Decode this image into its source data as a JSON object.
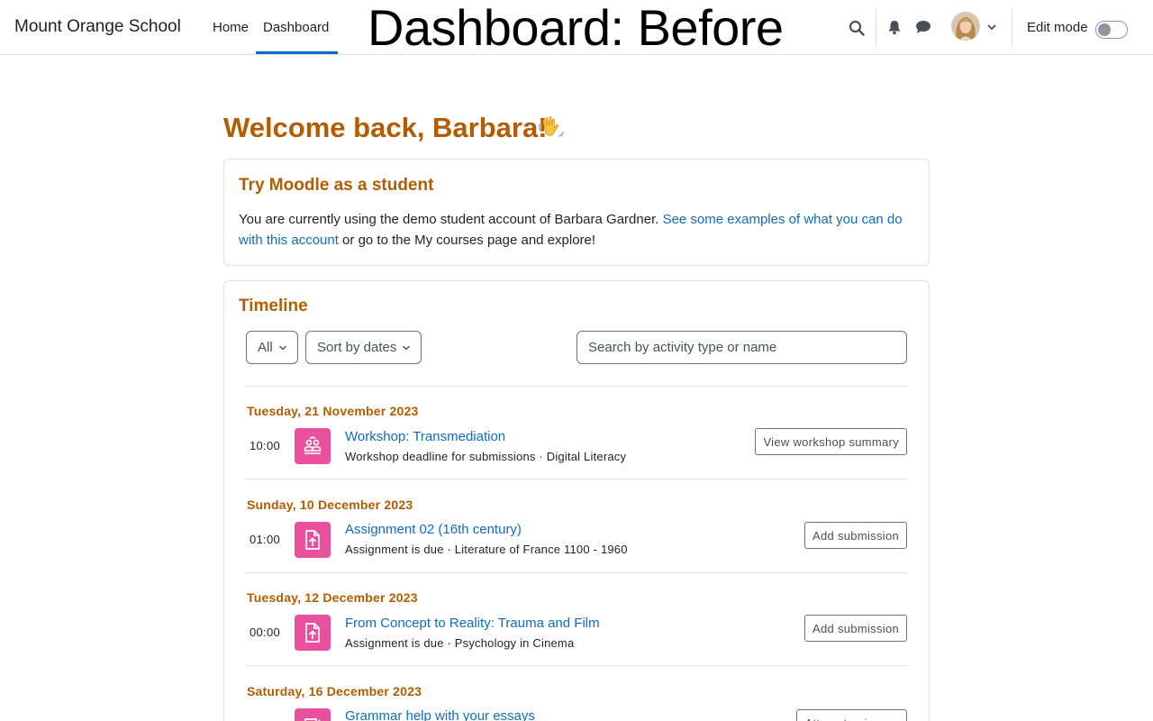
{
  "navbar": {
    "site_name": "Mount Orange School",
    "links": [
      {
        "label": "Home",
        "active": false
      },
      {
        "label": "Dashboard",
        "active": true
      }
    ],
    "overlay_title": "Dashboard: Before",
    "edit_mode_label": "Edit mode",
    "edit_mode_on": false
  },
  "welcome": {
    "text": "Welcome back, Barbara!",
    "emoji": "waving-hand"
  },
  "try_card": {
    "title": "Try Moodle as a student",
    "text_before": "You are currently using the demo student account of Barbara Gardner. ",
    "link_text": "See some examples of what you can do with this account",
    "text_after": " or go to the My courses page and explore!"
  },
  "timeline": {
    "title": "Timeline",
    "filter_selected": "All",
    "sort_selected": "Sort by dates",
    "search_placeholder": "Search by activity type or name",
    "groups": [
      {
        "date": "Tuesday, 21 November 2023",
        "time": "10:00",
        "icon": "workshop-icon",
        "name": "Workshop: Transmediation",
        "subtitle": "Workshop deadline for submissions · Digital Literacy",
        "action": "View workshop summary"
      },
      {
        "date": "Sunday, 10 December 2023",
        "time": "01:00",
        "icon": "assignment-icon",
        "name": "Assignment 02 (16th century)",
        "subtitle": "Assignment is due · Literature of France 1100 - 1960",
        "action": "Add submission"
      },
      {
        "date": "Tuesday, 12 December 2023",
        "time": "00:00",
        "icon": "assignment-icon",
        "name": "From Concept to Reality: Trauma and Film",
        "subtitle": "Assignment is due · Psychology in Cinema",
        "action": "Add submission"
      },
      {
        "date": "Saturday, 16 December 2023",
        "time": "",
        "icon": "quiz-icon",
        "name": "Grammar help with your essays",
        "subtitle": "",
        "action": "Attempt quiz now"
      }
    ]
  },
  "colors": {
    "accent_heading": "#b35c00",
    "link": "#0f6cbf",
    "activity_icon_bg": "#e9519f"
  }
}
